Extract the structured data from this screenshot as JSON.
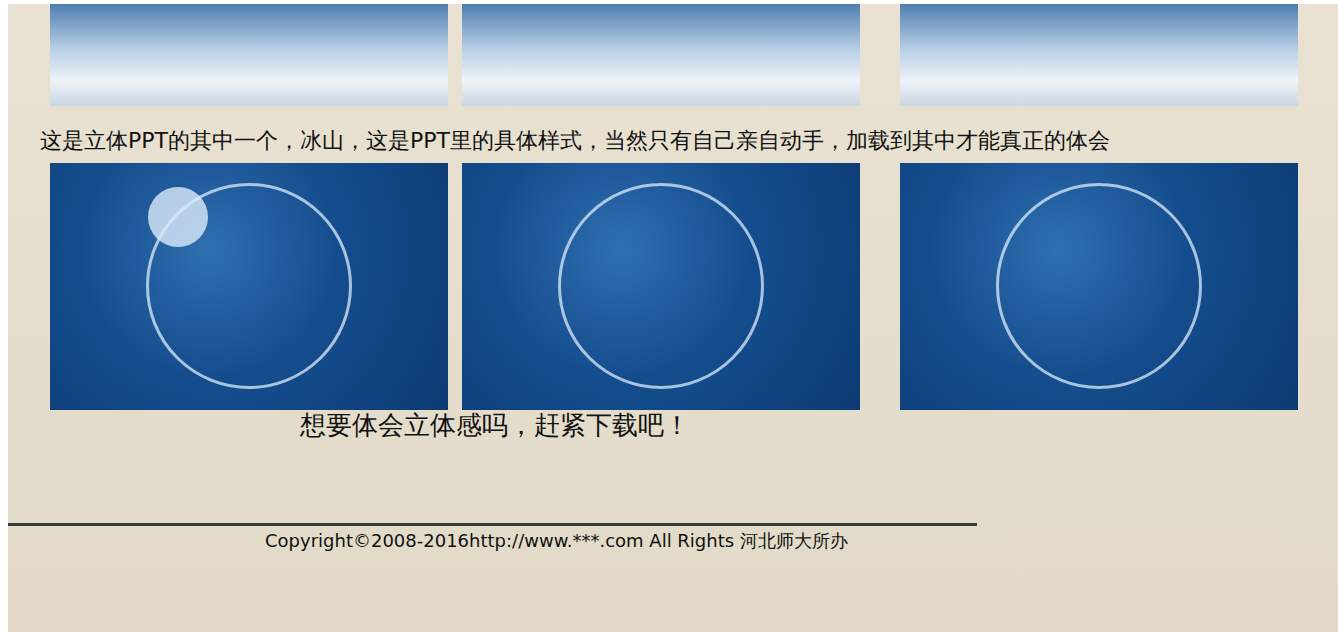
{
  "page": {
    "caption": "这是立体PPT的其中一个，冰山，这是PPT里的具体样式，当然只有自己亲自动手，加载到其中才能真正的体会",
    "call_to_action": "想要体会立体感吗，赶紧下载吧！",
    "footer": "Copyright©2008-2016http://www.***.com All Rights 河北师大所办"
  }
}
